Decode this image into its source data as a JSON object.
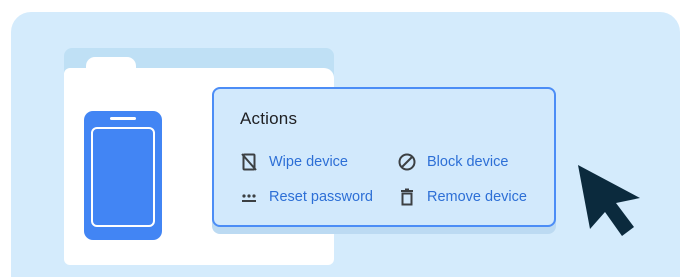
{
  "actions": {
    "title": "Actions",
    "items": [
      {
        "label": "Wipe device",
        "icon": "phone-off-icon"
      },
      {
        "label": "Block device",
        "icon": "block-icon"
      },
      {
        "label": "Reset password",
        "icon": "password-icon"
      },
      {
        "label": "Remove device",
        "icon": "trash-icon"
      }
    ]
  },
  "colors": {
    "background": "#d4ebfc",
    "accent": "#4285f4",
    "link": "#2d6fd6",
    "cursor": "#0b2a3d"
  }
}
